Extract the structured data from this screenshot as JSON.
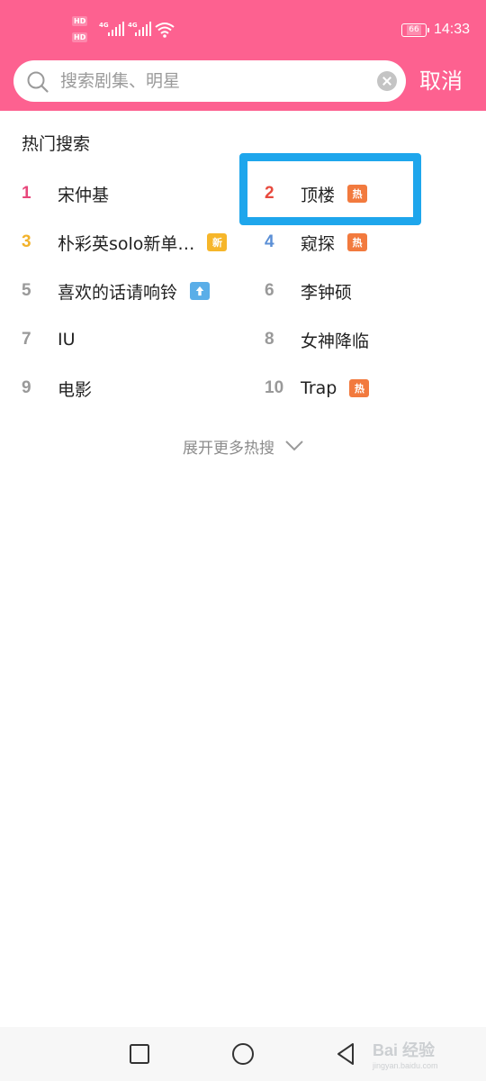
{
  "status_bar": {
    "hd1": "HD",
    "hd2": "HD",
    "sig1_label": "4G",
    "sig2_label": "4G",
    "battery": "66",
    "time": "14:33",
    "icons": [
      "signal-icon",
      "wifi-icon",
      "battery-icon"
    ]
  },
  "search": {
    "placeholder": "搜索剧集、明星",
    "value": "",
    "cancel_label": "取消"
  },
  "hot_search": {
    "title": "热门搜索",
    "items": [
      {
        "rank": "1",
        "term": "宋仲基",
        "tag": "",
        "rank_color": "#e8477b"
      },
      {
        "rank": "2",
        "term": "顶楼",
        "tag": "热",
        "rank_color": "#e84a3e"
      },
      {
        "rank": "3",
        "term": "朴彩英solo新单…",
        "tag": "新",
        "rank_color": "#f2b22b"
      },
      {
        "rank": "4",
        "term": "窥探",
        "tag": "热",
        "rank_color": "#5b8fd6"
      },
      {
        "rank": "5",
        "term": "喜欢的话请响铃",
        "tag": "up-arrow",
        "rank_color": "#999999"
      },
      {
        "rank": "6",
        "term": "李钟硕",
        "tag": "",
        "rank_color": "#999999"
      },
      {
        "rank": "7",
        "term": "IU",
        "tag": "",
        "rank_color": "#999999"
      },
      {
        "rank": "8",
        "term": "女神降临",
        "tag": "",
        "rank_color": "#999999"
      },
      {
        "rank": "9",
        "term": "电影",
        "tag": "",
        "rank_color": "#999999"
      },
      {
        "rank": "10",
        "term": "Trap",
        "tag": "热",
        "rank_color": "#999999"
      }
    ],
    "expand_label": "展开更多热搜"
  },
  "colors": {
    "header_bg": "#fd6190",
    "highlight": "#1ea6ec",
    "tag_hot": "#f27a3e",
    "tag_new": "#f6b62a",
    "tag_up": "#5aaee8"
  },
  "watermark": {
    "text": "Bai 经验",
    "sub": "jingyan.baidu.com"
  }
}
